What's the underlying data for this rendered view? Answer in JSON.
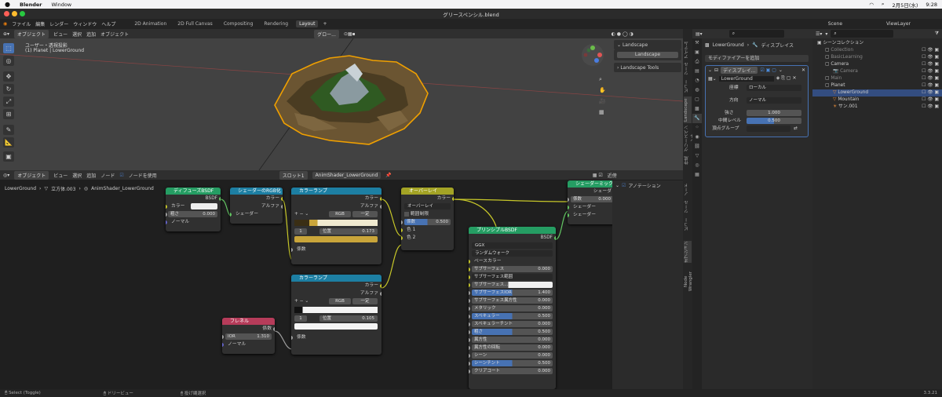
{
  "macbar": {
    "app": "Blender",
    "menu": "Window",
    "date": "2月5日(水)",
    "time": "9:28"
  },
  "window": {
    "title": "グリースペンシル.blend"
  },
  "topbar": {
    "menus": [
      "ファイル",
      "編集",
      "レンダー",
      "ウィンドウ",
      "ヘルプ"
    ],
    "workspaces": [
      "2D Animation",
      "2D Full Canvas",
      "Compositing",
      "Rendering",
      "Layout"
    ],
    "active_workspace": "Layout",
    "scene": "Scene",
    "viewlayer": "ViewLayer"
  },
  "viewport": {
    "mode": "オブジェクト",
    "menus": [
      "ビュー",
      "選択",
      "追加",
      "オブジェクト"
    ],
    "orientation": "グロー...",
    "view_label": "ユーザー・透視投影",
    "object_label": "(1) Planet | LowerGround",
    "npanel": {
      "section1": "Landscape",
      "button": "Landscape",
      "section2": "Landscape Tools"
    },
    "side_tabs": [
      "アイテム",
      "ツール",
      "ビュー",
      "Landscape",
      "グリースペンシル",
      "作成"
    ]
  },
  "node_editor": {
    "mode": "オブジェクト",
    "menus": [
      "ビュー",
      "選択",
      "追加",
      "ノード"
    ],
    "use_nodes": "ノードを使用",
    "slot": "スロット1",
    "material": "AnimShader_LowerGround",
    "breadcrumb": [
      "LowerGround",
      "立方体.003",
      "AnimShader_LowerGround"
    ],
    "overlay_label": "近傍",
    "side_tabs": [
      "ノード",
      "ツール",
      "ビュー",
      "オプション",
      "Node Wrangler"
    ],
    "annotation_label": "アノテーション",
    "nodes": {
      "diffuse": {
        "title": "ディフューズBSDF",
        "out": "BSDF",
        "color": "カラー",
        "rough_label": "粗さ",
        "rough": "0.000",
        "normal": "ノーマル"
      },
      "torgb": {
        "title": "シェーダーのRGB化",
        "color": "カラー",
        "alpha": "アルファ",
        "shader": "シェーダー"
      },
      "ramp1": {
        "title": "カラーランプ",
        "color": "カラー",
        "alpha": "アルファ",
        "mode": "RGB",
        "interp": "一定",
        "index": "1",
        "pos_label": "位置",
        "pos": "0.173",
        "fac": "係数"
      },
      "ramp2": {
        "title": "カラーランプ",
        "color": "カラー",
        "alpha": "アルファ",
        "mode": "RGB",
        "interp": "一定",
        "index": "1",
        "pos_label": "位置",
        "pos": "0.105",
        "fac": "係数"
      },
      "overlay": {
        "title": "オーバーレイ",
        "out": "カラー",
        "blend": "オーバーレイ",
        "clamp": "範囲制限",
        "fac_label": "係数",
        "fac": "0.500",
        "c1": "色 1",
        "c2": "色 2"
      },
      "fresnel": {
        "title": "フレネル",
        "out": "係数",
        "ior_label": "IOR",
        "ior": "1.310",
        "normal": "ノーマル"
      },
      "mix": {
        "title": "シェーダーミック",
        "out": "シェーダ",
        "fac_label": "係数",
        "fac": "0.000",
        "s1": "シェーダー",
        "s2": "シェーダー"
      },
      "principled": {
        "title": "プリンシプルBSDF",
        "out": "BSDF",
        "dist": "GGX",
        "sss": "ランダムウォーク",
        "base": "ベースカラー",
        "rows": [
          {
            "label": "サブサーフェス",
            "value": "0.000"
          },
          {
            "label": "サブサーフェス範囲",
            "value": ""
          },
          {
            "label": "サブサーフェス...",
            "value": ""
          },
          {
            "label": "サブサーフェスIOR",
            "value": "1.400"
          },
          {
            "label": "サブサーフェス異方性",
            "value": "0.000"
          },
          {
            "label": "メタリック",
            "value": "0.000"
          },
          {
            "label": "スペキュラー",
            "value": "0.500"
          },
          {
            "label": "スペキュラーチント",
            "value": "0.000"
          },
          {
            "label": "粗さ",
            "value": "0.500"
          },
          {
            "label": "異方性",
            "value": "0.000"
          },
          {
            "label": "異方性の回転",
            "value": "0.000"
          },
          {
            "label": "シーン",
            "value": "0.000"
          },
          {
            "label": "シーンチント",
            "value": "0.500"
          },
          {
            "label": "クリアコート",
            "value": "0.000"
          }
        ]
      }
    }
  },
  "properties": {
    "object": "LowerGround",
    "modifier_tab": "ディスプレイス",
    "add_modifier": "モディファイアーを追加",
    "modifier_name": "ディスプレイ...",
    "texture": "LowerGround",
    "coords_label": "座標",
    "coords": "ローカル",
    "dir_label": "方向",
    "dir": "ノーマル",
    "strength_label": "強さ",
    "strength": "1.000",
    "mid_label": "中間レベル",
    "mid": "0.500",
    "vgroup_label": "頂点グループ"
  },
  "outliner": {
    "items": [
      {
        "label": "シーンコレクション",
        "depth": 0
      },
      {
        "label": "Collection",
        "depth": 1
      },
      {
        "label": "BasicLearning",
        "depth": 1
      },
      {
        "label": "Camera",
        "depth": 1
      },
      {
        "label": "Camera",
        "depth": 2
      },
      {
        "label": "Main",
        "depth": 1
      },
      {
        "label": "Planet",
        "depth": 1
      },
      {
        "label": "LowerGround",
        "depth": 2
      },
      {
        "label": "Mountain",
        "depth": 2
      },
      {
        "label": "サン.001",
        "depth": 2
      }
    ]
  },
  "status": {
    "select": "Select (Toggle)",
    "pan": "ドリービュー",
    "menu": "投げ縄選択",
    "version": "3.3.21"
  },
  "colors": {
    "accent": "#4772b3",
    "selection": "#f0a000"
  }
}
